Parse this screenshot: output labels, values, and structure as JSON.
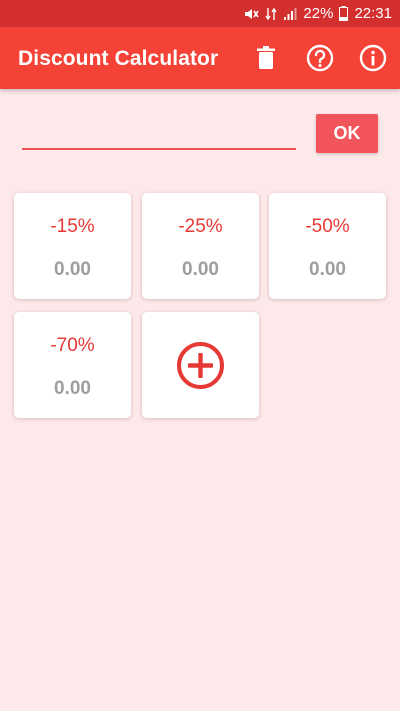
{
  "status_bar": {
    "battery": "22%",
    "time": "22:31"
  },
  "app_bar": {
    "title": "Discount Calculator",
    "actions": [
      "trash-icon",
      "help-icon",
      "info-icon"
    ]
  },
  "input": {
    "value": "",
    "placeholder": ""
  },
  "ok_button": {
    "label": "OK"
  },
  "discounts": [
    {
      "percent": "-15%",
      "amount": "0.00"
    },
    {
      "percent": "-25%",
      "amount": "0.00"
    },
    {
      "percent": "-50%",
      "amount": "0.00"
    },
    {
      "percent": "-70%",
      "amount": "0.00"
    }
  ],
  "add_card": {
    "icon": "plus-circle-icon"
  },
  "colors": {
    "status_bar": "#d32f2f",
    "app_bar": "#f44336",
    "background": "#fde8ea",
    "accent": "#e53935",
    "ok_button": "#f2545b",
    "amount_text": "#9e9e9e"
  }
}
